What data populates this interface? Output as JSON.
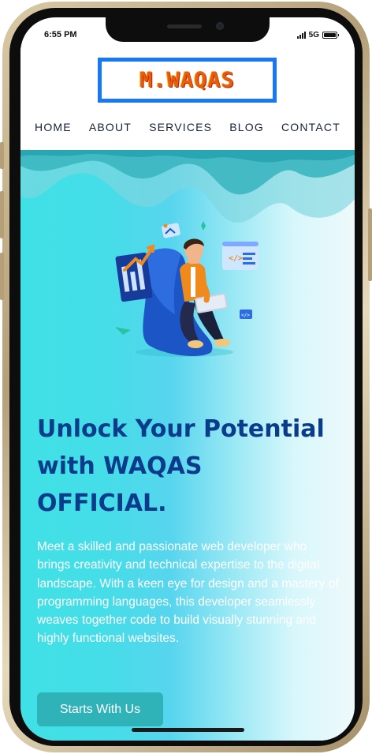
{
  "status_bar": {
    "time": "6:55 PM",
    "network": "5G",
    "icons": [
      "signal-icon",
      "battery-icon"
    ]
  },
  "header": {
    "logo_text": "M.WAQAS",
    "nav": [
      {
        "label": "HOME"
      },
      {
        "label": "ABOUT"
      },
      {
        "label": "SERVICES"
      },
      {
        "label": "BLOG"
      },
      {
        "label": "CONTACT"
      }
    ]
  },
  "hero": {
    "title_line1": "Unlock Your Potential",
    "title_line2": "with WAQAS",
    "title_line3": "OFFICIAL.",
    "description": "Meet a skilled and passionate web developer who brings creativity and technical expertise to the digital landscape. With a keen eye for design and a mastery of programming languages, this developer seamlessly weaves together code to build visually stunning and highly functional websites.",
    "cta_label": "Starts With Us",
    "illustration": "developer-with-laptop-illustration"
  },
  "colors": {
    "brand_blue": "#1877f2",
    "logo_orange": "#e85d0c",
    "title_navy": "#0b3c8c",
    "hero_cyan": "#3fe1e6",
    "button_teal": "#2fb2b8"
  }
}
